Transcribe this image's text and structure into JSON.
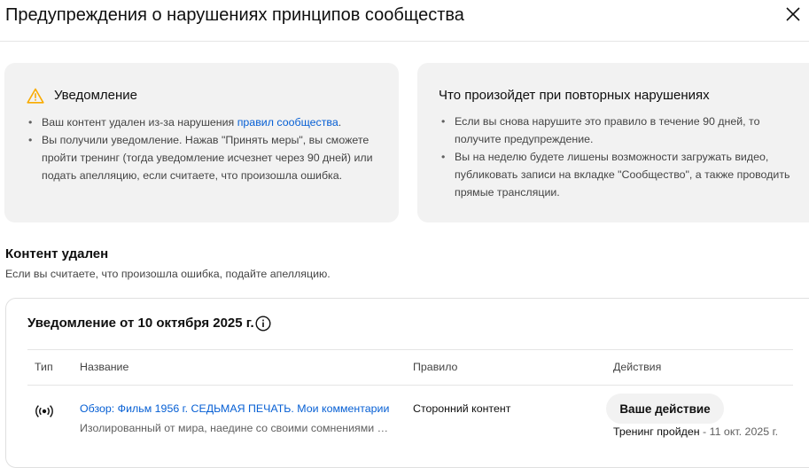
{
  "header": {
    "title": "Предупреждения о нарушениях принципов сообщества"
  },
  "notice_card": {
    "title": "Уведомление",
    "item1_text": "Ваш контент удален из-за нарушения ",
    "item1_link": "правил сообщества",
    "item1_end": ".",
    "item2_text": "Вы получили уведомление. Нажав \"Принять меры\", вы сможете пройти тренинг (тогда уведомление исчезнет через 90 дней) или подать апелляцию, если считаете, что произошла ошибка."
  },
  "repeat_card": {
    "title": "Что произойдет при повторных нарушениях",
    "items": [
      "Если вы снова нарушите это правило в течение 90 дней, то получите предупреждение.",
      "Вы на неделю будете лишены возможности загружать видео, публиковать записи на вкладке \"Сообщество\", а также проводить прямые трансляции."
    ]
  },
  "content_removed": {
    "title": "Контент удален",
    "subtitle": "Если вы считаете, что произошла ошибка, подайте апелляцию."
  },
  "panel": {
    "title": "Уведомление от 10 октября 2025 г.",
    "columns": {
      "type": "Тип",
      "name": "Название",
      "rule": "Правило",
      "actions": "Действия"
    },
    "row": {
      "type_icon": "live-broadcast-icon",
      "title": "Обзор: Фильм 1956 г. СЕДЬМАЯ ПЕЧАТЬ. Мои комментарии",
      "description": "Изолированный от мира, наедине со своими сомнениями и страхами",
      "rule": "Сторонний контент",
      "action_button": "Ваше действие",
      "status_label": "Тренинг пройден",
      "status_date": " - 11 окт. 2025 г."
    }
  },
  "colors": {
    "link": "#065fd4",
    "card_bg": "#f2f2f2",
    "warning": "#f9ab00"
  }
}
